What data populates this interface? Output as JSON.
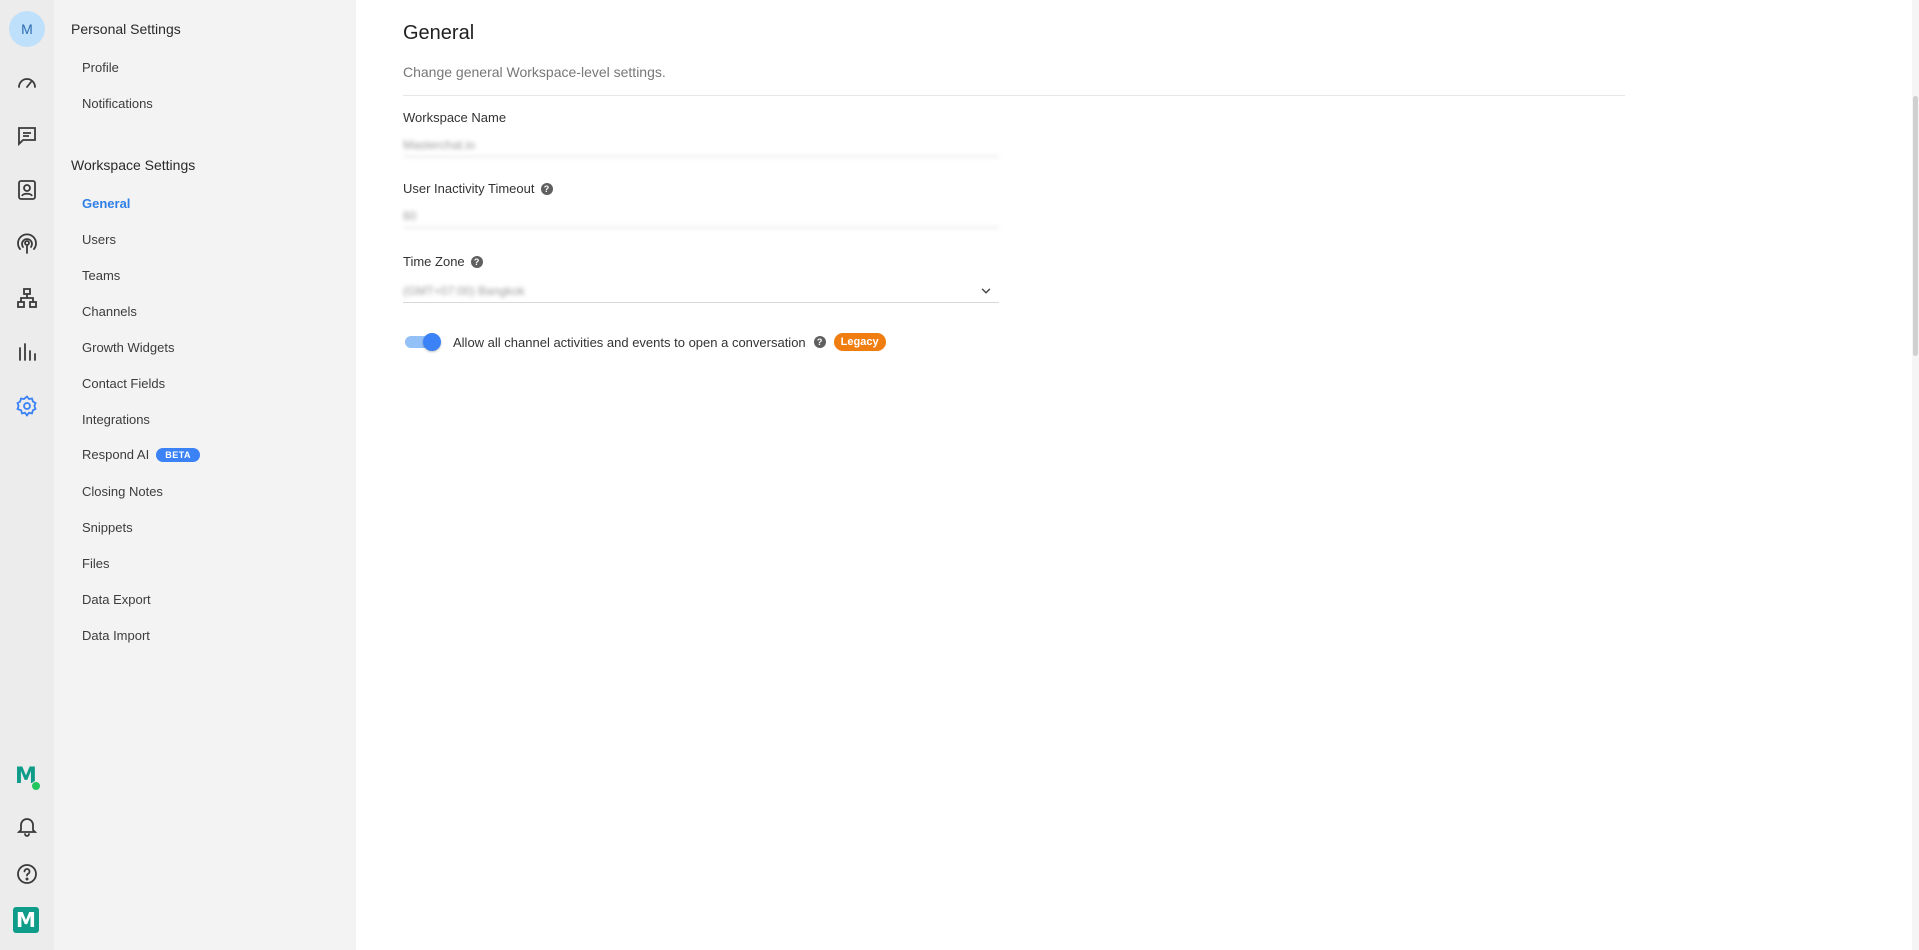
{
  "rail": {
    "avatar_initial": "M",
    "top_icons": [
      "dashboard-icon",
      "messages-icon",
      "contacts-icon",
      "broadcast-icon",
      "workflows-icon",
      "reports-icon",
      "settings-icon"
    ],
    "active_icon": "settings-icon",
    "bottom_icons": [
      "brand-status-icon",
      "bell-icon",
      "help-icon",
      "brand-logo-icon"
    ],
    "brand_letter": "M",
    "accent_color": "#3b82f6"
  },
  "sidebar": {
    "personal_title": "Personal Settings",
    "personal_items": [
      {
        "label": "Profile"
      },
      {
        "label": "Notifications"
      }
    ],
    "workspace_title": "Workspace Settings",
    "workspace_items": [
      {
        "label": "General",
        "active": true
      },
      {
        "label": "Users"
      },
      {
        "label": "Teams"
      },
      {
        "label": "Channels"
      },
      {
        "label": "Growth Widgets"
      },
      {
        "label": "Contact Fields"
      },
      {
        "label": "Integrations"
      },
      {
        "label": "Respond AI",
        "badge": "BETA"
      },
      {
        "label": "Closing Notes"
      },
      {
        "label": "Snippets"
      },
      {
        "label": "Files"
      },
      {
        "label": "Data Export"
      },
      {
        "label": "Data Import"
      }
    ]
  },
  "main": {
    "title": "General",
    "subtitle": "Change general Workspace-level settings.",
    "workspace_name": {
      "label": "Workspace Name",
      "value": "Masterchat.io"
    },
    "inactivity_timeout": {
      "label": "User Inactivity Timeout",
      "value": "60"
    },
    "time_zone": {
      "label": "Time Zone",
      "value": "(GMT+07:00) Bangkok"
    },
    "toggle": {
      "label": "Allow all channel activities and events to open a conversation",
      "on": true,
      "badge": "Legacy",
      "badge_color": "#f07d0f"
    }
  }
}
